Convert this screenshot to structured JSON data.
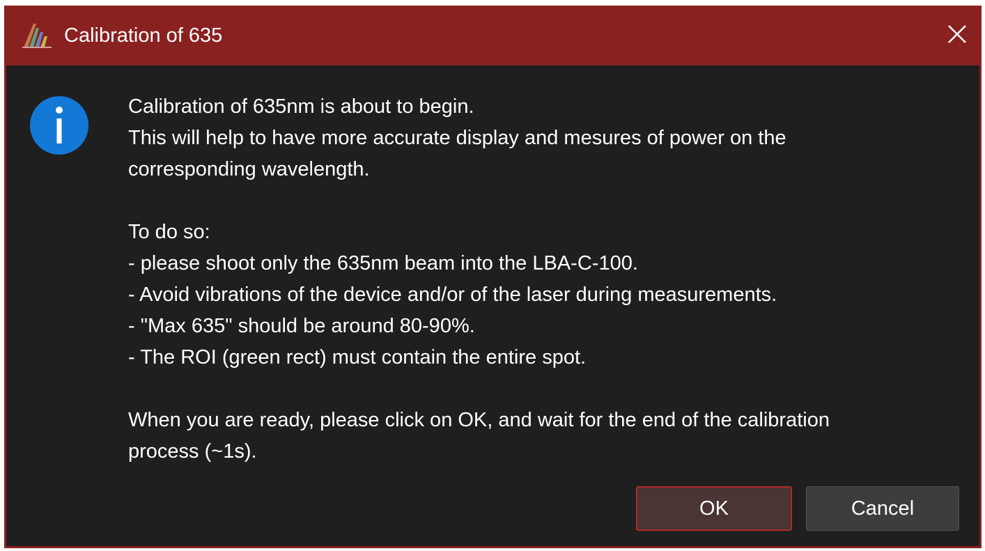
{
  "window": {
    "title": "Calibration of 635",
    "app_icon": "lba-app-icon",
    "close_icon": "close-icon",
    "title_bar_color": "#8a2121",
    "background_color": "#1f1f1f"
  },
  "message": {
    "icon": "info-icon",
    "icon_color": "#1479d6",
    "intro": [
      "Calibration of 635nm is about to begin.",
      "This will help to have more accurate display and mesures of power on the",
      "corresponding wavelength."
    ],
    "instructions_heading": "To do so:",
    "instructions": [
      "- please shoot only the 635nm beam into the LBA-C-100.",
      "- Avoid vibrations of the device and/or of the laser during measurements.",
      "- \"Max 635\" should be around 80-90%.",
      "- The ROI (green rect) must contain the entire spot."
    ],
    "outro": [
      "When you are ready, please click on OK, and wait for the end of the calibration",
      "process (~1s)."
    ]
  },
  "buttons": {
    "ok_label": "OK",
    "cancel_label": "Cancel"
  }
}
